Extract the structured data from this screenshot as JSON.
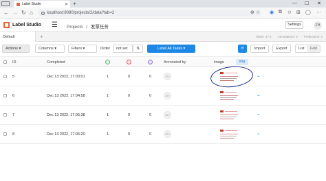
{
  "browser": {
    "tab_title": "Label Studio",
    "url": "localhost:8080/projects/2/data?tab=2"
  },
  "app": {
    "brand": "Label Studio",
    "breadcrumb": {
      "projects": "Projects",
      "separator": "/",
      "current": "发票任务"
    },
    "settings_label": "Settings",
    "user_initials": "ZH"
  },
  "view_tabs": {
    "tabs": [
      {
        "label": "Default"
      }
    ],
    "add_label": "+",
    "stats": {
      "tasks": "Tasks: 4 / 4",
      "annotations": "Annotations: 0",
      "predictions": "Predictions: 0"
    }
  },
  "toolbar": {
    "actions": "Actions",
    "columns": "Columns",
    "filters": "Filters",
    "order_label": "Order",
    "order_value": "not set",
    "label_all": "Label All Tasks",
    "import": "Import",
    "export": "Export",
    "view_list": "List",
    "view_grid": "Grid"
  },
  "table": {
    "headers": {
      "id": "ID",
      "completed": "Completed",
      "annotated_by": "Annotated by",
      "image": "image",
      "image_tag": "img"
    },
    "rows": [
      {
        "id": "5",
        "completed": "Dec 13 2022, 17:03:01",
        "annotations": "1",
        "cancelled": "0",
        "predictions": "0",
        "annotator": "ZH"
      },
      {
        "id": "6",
        "completed": "Dec 13 2022, 17:04:58",
        "annotations": "1",
        "cancelled": "0",
        "predictions": "0",
        "annotator": "ZH"
      },
      {
        "id": "7",
        "completed": "Dec 13 2022, 17:05:38",
        "annotations": "1",
        "cancelled": "0",
        "predictions": "0",
        "annotator": "ZH"
      },
      {
        "id": "8",
        "completed": "Dec 13 2022, 17:06:20",
        "annotations": "1",
        "cancelled": "0",
        "predictions": "0",
        "annotator": "ZH"
      }
    ]
  },
  "colors": {
    "accent": "#1e88e5",
    "brand": "#e8633a",
    "annotation_circle": "#1d2a8c"
  }
}
